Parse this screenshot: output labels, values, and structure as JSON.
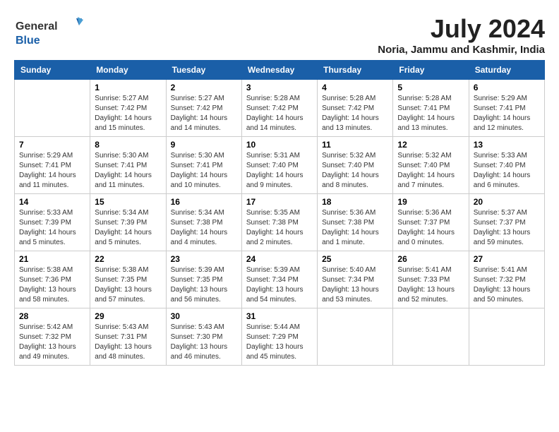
{
  "header": {
    "logo_general": "General",
    "logo_blue": "Blue",
    "month": "July 2024",
    "location": "Noria, Jammu and Kashmir, India"
  },
  "weekdays": [
    "Sunday",
    "Monday",
    "Tuesday",
    "Wednesday",
    "Thursday",
    "Friday",
    "Saturday"
  ],
  "weeks": [
    [
      {
        "day": "",
        "info": ""
      },
      {
        "day": "1",
        "info": "Sunrise: 5:27 AM\nSunset: 7:42 PM\nDaylight: 14 hours\nand 15 minutes."
      },
      {
        "day": "2",
        "info": "Sunrise: 5:27 AM\nSunset: 7:42 PM\nDaylight: 14 hours\nand 14 minutes."
      },
      {
        "day": "3",
        "info": "Sunrise: 5:28 AM\nSunset: 7:42 PM\nDaylight: 14 hours\nand 14 minutes."
      },
      {
        "day": "4",
        "info": "Sunrise: 5:28 AM\nSunset: 7:42 PM\nDaylight: 14 hours\nand 13 minutes."
      },
      {
        "day": "5",
        "info": "Sunrise: 5:28 AM\nSunset: 7:41 PM\nDaylight: 14 hours\nand 13 minutes."
      },
      {
        "day": "6",
        "info": "Sunrise: 5:29 AM\nSunset: 7:41 PM\nDaylight: 14 hours\nand 12 minutes."
      }
    ],
    [
      {
        "day": "7",
        "info": "Sunrise: 5:29 AM\nSunset: 7:41 PM\nDaylight: 14 hours\nand 11 minutes."
      },
      {
        "day": "8",
        "info": "Sunrise: 5:30 AM\nSunset: 7:41 PM\nDaylight: 14 hours\nand 11 minutes."
      },
      {
        "day": "9",
        "info": "Sunrise: 5:30 AM\nSunset: 7:41 PM\nDaylight: 14 hours\nand 10 minutes."
      },
      {
        "day": "10",
        "info": "Sunrise: 5:31 AM\nSunset: 7:40 PM\nDaylight: 14 hours\nand 9 minutes."
      },
      {
        "day": "11",
        "info": "Sunrise: 5:32 AM\nSunset: 7:40 PM\nDaylight: 14 hours\nand 8 minutes."
      },
      {
        "day": "12",
        "info": "Sunrise: 5:32 AM\nSunset: 7:40 PM\nDaylight: 14 hours\nand 7 minutes."
      },
      {
        "day": "13",
        "info": "Sunrise: 5:33 AM\nSunset: 7:40 PM\nDaylight: 14 hours\nand 6 minutes."
      }
    ],
    [
      {
        "day": "14",
        "info": "Sunrise: 5:33 AM\nSunset: 7:39 PM\nDaylight: 14 hours\nand 5 minutes."
      },
      {
        "day": "15",
        "info": "Sunrise: 5:34 AM\nSunset: 7:39 PM\nDaylight: 14 hours\nand 5 minutes."
      },
      {
        "day": "16",
        "info": "Sunrise: 5:34 AM\nSunset: 7:38 PM\nDaylight: 14 hours\nand 4 minutes."
      },
      {
        "day": "17",
        "info": "Sunrise: 5:35 AM\nSunset: 7:38 PM\nDaylight: 14 hours\nand 2 minutes."
      },
      {
        "day": "18",
        "info": "Sunrise: 5:36 AM\nSunset: 7:38 PM\nDaylight: 14 hours\nand 1 minute."
      },
      {
        "day": "19",
        "info": "Sunrise: 5:36 AM\nSunset: 7:37 PM\nDaylight: 14 hours\nand 0 minutes."
      },
      {
        "day": "20",
        "info": "Sunrise: 5:37 AM\nSunset: 7:37 PM\nDaylight: 13 hours\nand 59 minutes."
      }
    ],
    [
      {
        "day": "21",
        "info": "Sunrise: 5:38 AM\nSunset: 7:36 PM\nDaylight: 13 hours\nand 58 minutes."
      },
      {
        "day": "22",
        "info": "Sunrise: 5:38 AM\nSunset: 7:35 PM\nDaylight: 13 hours\nand 57 minutes."
      },
      {
        "day": "23",
        "info": "Sunrise: 5:39 AM\nSunset: 7:35 PM\nDaylight: 13 hours\nand 56 minutes."
      },
      {
        "day": "24",
        "info": "Sunrise: 5:39 AM\nSunset: 7:34 PM\nDaylight: 13 hours\nand 54 minutes."
      },
      {
        "day": "25",
        "info": "Sunrise: 5:40 AM\nSunset: 7:34 PM\nDaylight: 13 hours\nand 53 minutes."
      },
      {
        "day": "26",
        "info": "Sunrise: 5:41 AM\nSunset: 7:33 PM\nDaylight: 13 hours\nand 52 minutes."
      },
      {
        "day": "27",
        "info": "Sunrise: 5:41 AM\nSunset: 7:32 PM\nDaylight: 13 hours\nand 50 minutes."
      }
    ],
    [
      {
        "day": "28",
        "info": "Sunrise: 5:42 AM\nSunset: 7:32 PM\nDaylight: 13 hours\nand 49 minutes."
      },
      {
        "day": "29",
        "info": "Sunrise: 5:43 AM\nSunset: 7:31 PM\nDaylight: 13 hours\nand 48 minutes."
      },
      {
        "day": "30",
        "info": "Sunrise: 5:43 AM\nSunset: 7:30 PM\nDaylight: 13 hours\nand 46 minutes."
      },
      {
        "day": "31",
        "info": "Sunrise: 5:44 AM\nSunset: 7:29 PM\nDaylight: 13 hours\nand 45 minutes."
      },
      {
        "day": "",
        "info": ""
      },
      {
        "day": "",
        "info": ""
      },
      {
        "day": "",
        "info": ""
      }
    ]
  ]
}
